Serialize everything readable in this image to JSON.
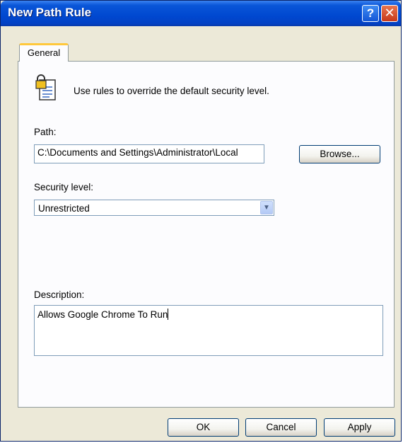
{
  "window": {
    "title": "New Path Rule",
    "help_glyph": "?",
    "close_glyph": "✕"
  },
  "tabs": [
    {
      "label": "General",
      "selected": true
    }
  ],
  "general": {
    "icon": "document-lock-icon",
    "intro_text": "Use rules to override the default security level.",
    "path_label": "Path:",
    "path_value": "C:\\Documents and Settings\\Administrator\\Local",
    "browse_label": "Browse...",
    "security_level_label": "Security level:",
    "security_level_value": "Unrestricted",
    "description_label": "Description:",
    "description_value": "Allows Google Chrome To Run"
  },
  "footer": {
    "ok_label": "OK",
    "cancel_label": "Cancel",
    "apply_label": "Apply"
  },
  "colors": {
    "titlebar": "#0048d0",
    "dialog_face": "#ece9d8",
    "tab_accent": "#ffc83c",
    "field_border": "#7f9db9"
  }
}
